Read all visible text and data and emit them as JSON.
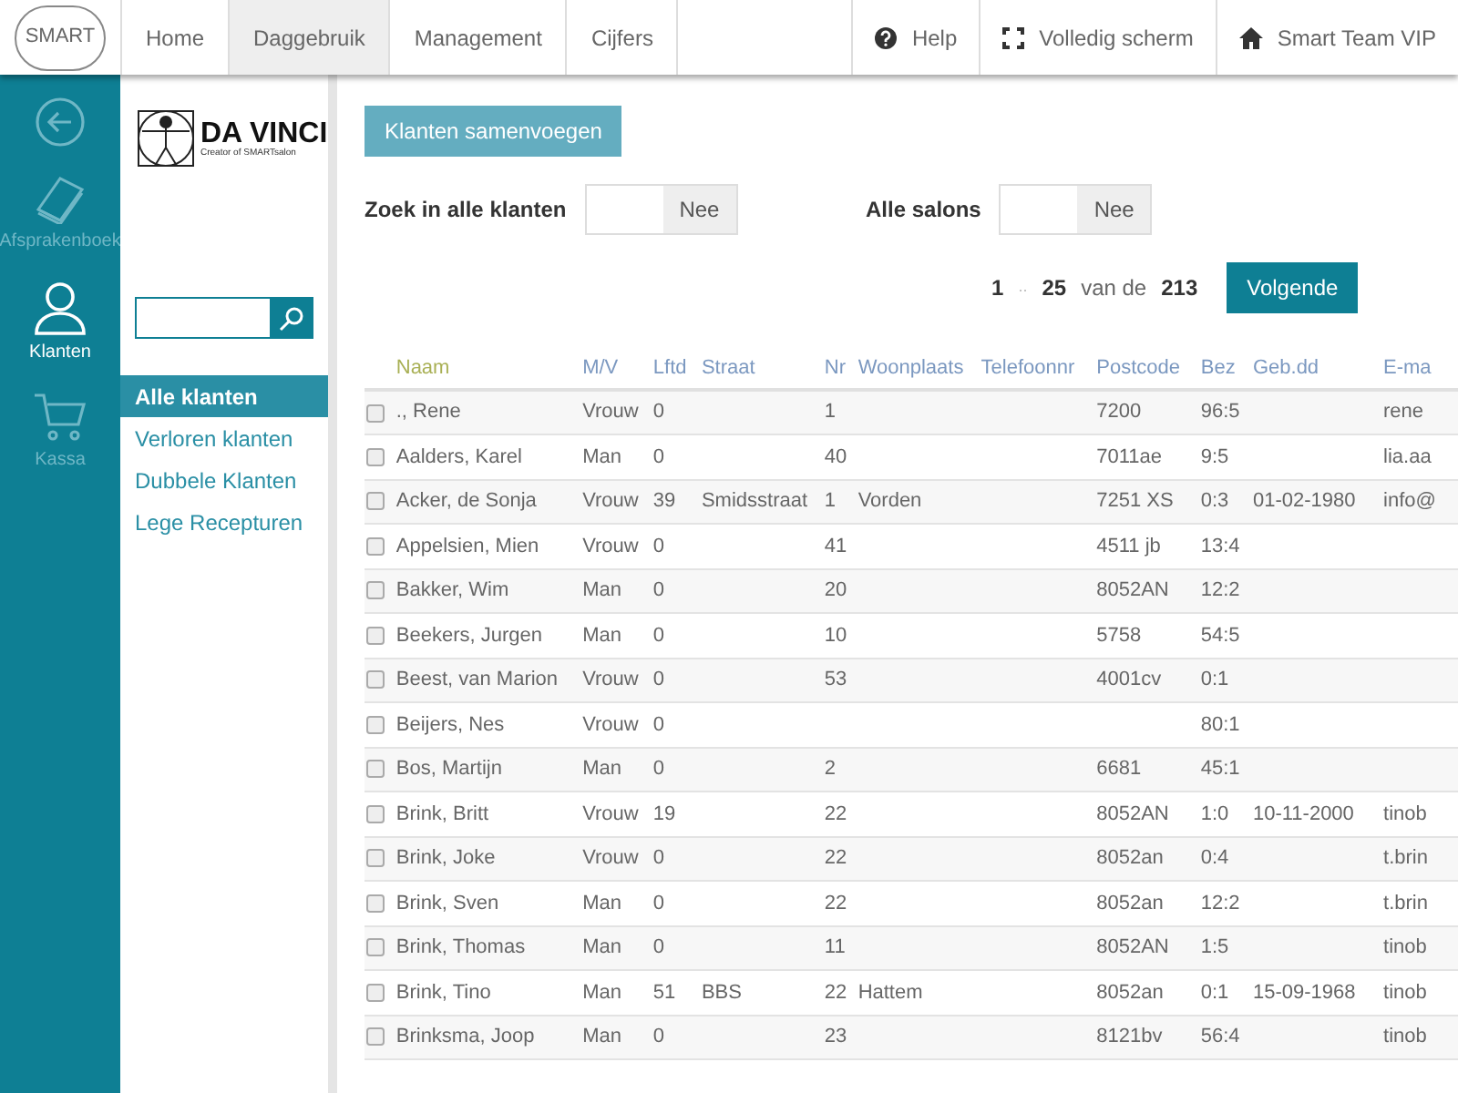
{
  "logo": "SMART",
  "nav_tabs": [
    {
      "label": "Home",
      "selected": false
    },
    {
      "label": "Daggebruik",
      "selected": true
    },
    {
      "label": "Management",
      "selected": false
    },
    {
      "label": "Cijfers",
      "selected": false
    }
  ],
  "nav_actions": [
    {
      "kind": "help",
      "label": "Help"
    },
    {
      "kind": "fullscreen",
      "label": "Volledig scherm"
    },
    {
      "kind": "home",
      "label": "Smart Team VIP"
    }
  ],
  "rail": [
    {
      "kind": "back",
      "selected": false
    },
    {
      "kind": "book",
      "label": "Afsprakenboek",
      "selected": false
    },
    {
      "kind": "person",
      "label": "Klanten",
      "selected": true
    },
    {
      "kind": "cart",
      "label": "Kassa",
      "selected": false
    }
  ],
  "brand": {
    "name": "DA VINCI",
    "tagline": "Creator of SMARTsalon"
  },
  "menu": [
    {
      "label": "Alle klanten",
      "selected": true
    },
    {
      "label": "Verloren klanten",
      "selected": false
    },
    {
      "label": "Dubbele Klanten",
      "selected": false
    },
    {
      "label": "Lege Recepturen",
      "selected": false
    }
  ],
  "merge_button": "Klanten samenvoegen",
  "filters": [
    {
      "label": "Zoek in alle klanten",
      "value": "Nee",
      "on": false
    },
    {
      "label": "Alle salons",
      "value": "Nee",
      "on": false
    }
  ],
  "pager": {
    "from": "1",
    "sep": "..",
    "to": "25",
    "of": "van de",
    "total": "213",
    "next": "Volgende"
  },
  "table": {
    "columns": [
      {
        "label": "Naam",
        "sorted": true
      },
      {
        "label": "M/V",
        "sorted": false
      },
      {
        "label": "Lftd",
        "sorted": false
      },
      {
        "label": "Straat",
        "sorted": false
      },
      {
        "label": "Nr",
        "sorted": false
      },
      {
        "label": "Woonplaats",
        "sorted": false
      },
      {
        "label": "Telefoonnr",
        "sorted": false
      },
      {
        "label": "Postcode",
        "sorted": false
      },
      {
        "label": "Bez",
        "sorted": false
      },
      {
        "label": "Geb.dd",
        "sorted": false
      },
      {
        "label": "E-ma",
        "sorted": false
      }
    ],
    "rows": [
      {
        "checked": false,
        "cells": [
          "., Rene",
          "Vrouw",
          "0",
          "",
          "1",
          "",
          "",
          "7200",
          "96:5",
          "",
          "rene"
        ]
      },
      {
        "checked": false,
        "cells": [
          "Aalders, Karel",
          "Man",
          "0",
          "",
          "40",
          "",
          "",
          "7011ae",
          "9:5",
          "",
          "lia.aa"
        ]
      },
      {
        "checked": false,
        "cells": [
          "Acker, de Sonja",
          "Vrouw",
          "39",
          "Smidsstraat",
          "1",
          "Vorden",
          "",
          "7251 XS",
          "0:3",
          "01-02-1980",
          "info@"
        ]
      },
      {
        "checked": false,
        "cells": [
          "Appelsien, Mien",
          "Vrouw",
          "0",
          "",
          "41",
          "",
          "",
          "4511 jb",
          "13:4",
          "",
          ""
        ]
      },
      {
        "checked": false,
        "cells": [
          "Bakker, Wim",
          "Man",
          "0",
          "",
          "20",
          "",
          "",
          "8052AN",
          "12:2",
          "",
          ""
        ]
      },
      {
        "checked": false,
        "cells": [
          "Beekers, Jurgen",
          "Man",
          "0",
          "",
          "10",
          "",
          "",
          "5758",
          "54:5",
          "",
          ""
        ]
      },
      {
        "checked": false,
        "cells": [
          "Beest, van Marion",
          "Vrouw",
          "0",
          "",
          "53",
          "",
          "",
          "4001cv",
          "0:1",
          "",
          ""
        ]
      },
      {
        "checked": false,
        "cells": [
          "Beijers, Nes",
          "Vrouw",
          "0",
          "",
          "",
          "",
          "",
          "",
          "80:1",
          "",
          ""
        ]
      },
      {
        "checked": false,
        "cells": [
          "Bos, Martijn",
          "Man",
          "0",
          "",
          "2",
          "",
          "",
          "6681",
          "45:1",
          "",
          ""
        ]
      },
      {
        "checked": false,
        "cells": [
          "Brink, Britt",
          "Vrouw",
          "19",
          "",
          "22",
          "",
          "",
          "8052AN",
          "1:0",
          "10-11-2000",
          "tinob"
        ]
      },
      {
        "checked": false,
        "cells": [
          "Brink, Joke",
          "Vrouw",
          "0",
          "",
          "22",
          "",
          "",
          "8052an",
          "0:4",
          "",
          "t.brin"
        ]
      },
      {
        "checked": false,
        "cells": [
          "Brink, Sven",
          "Man",
          "0",
          "",
          "22",
          "",
          "",
          "8052an",
          "12:2",
          "",
          "t.brin"
        ]
      },
      {
        "checked": false,
        "cells": [
          "Brink, Thomas",
          "Man",
          "0",
          "",
          "11",
          "",
          "",
          "8052AN",
          "1:5",
          "",
          "tinob"
        ]
      },
      {
        "checked": false,
        "cells": [
          "Brink, Tino",
          "Man",
          "51",
          "BBS",
          "22",
          "Hattem",
          "",
          "8052an",
          "0:1",
          "15-09-1968",
          "tinob"
        ]
      },
      {
        "checked": false,
        "cells": [
          "Brinksma, Joop",
          "Man",
          "0",
          "",
          "23",
          "",
          "",
          "8121bv",
          "56:4",
          "",
          "tinob"
        ]
      }
    ]
  }
}
